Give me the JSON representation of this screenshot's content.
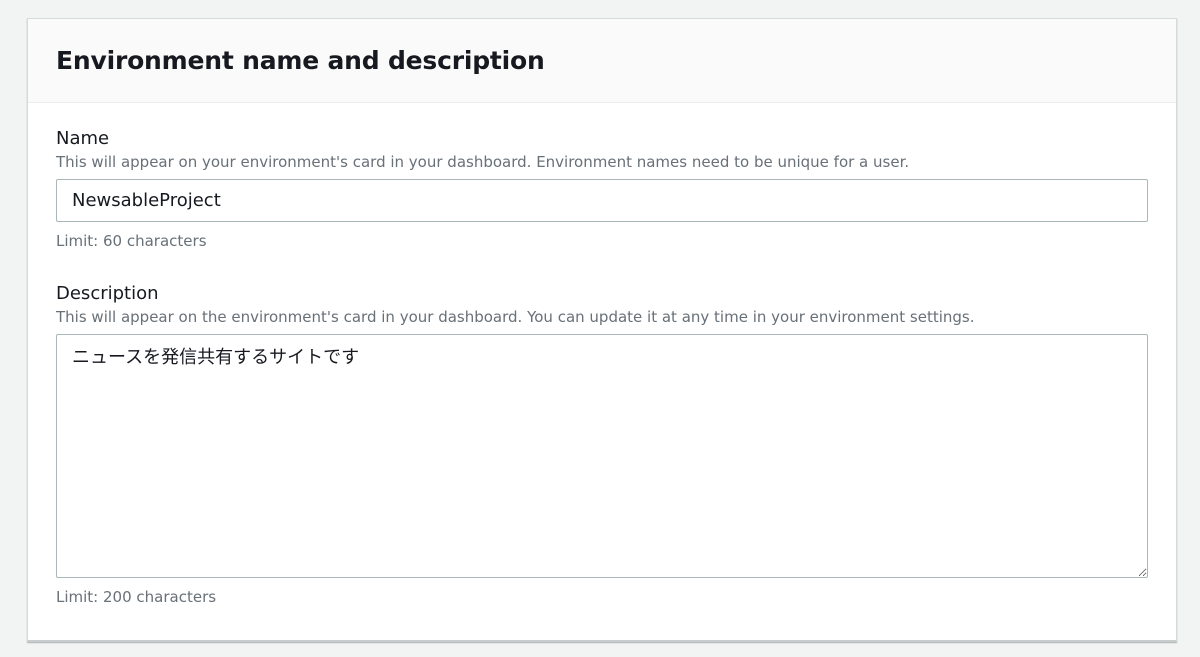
{
  "panel": {
    "title": "Environment name and description"
  },
  "name_field": {
    "label": "Name",
    "hint": "This will appear on your environment's card in your dashboard. Environment names need to be unique for a user.",
    "value": "NewsableProject",
    "constraint": "Limit: 60 characters"
  },
  "description_field": {
    "label": "Description",
    "hint": "This will appear on the environment's card in your dashboard. You can update it at any time in your environment settings.",
    "value": "ニュースを発信共有するサイトです",
    "constraint": "Limit: 200 characters"
  }
}
